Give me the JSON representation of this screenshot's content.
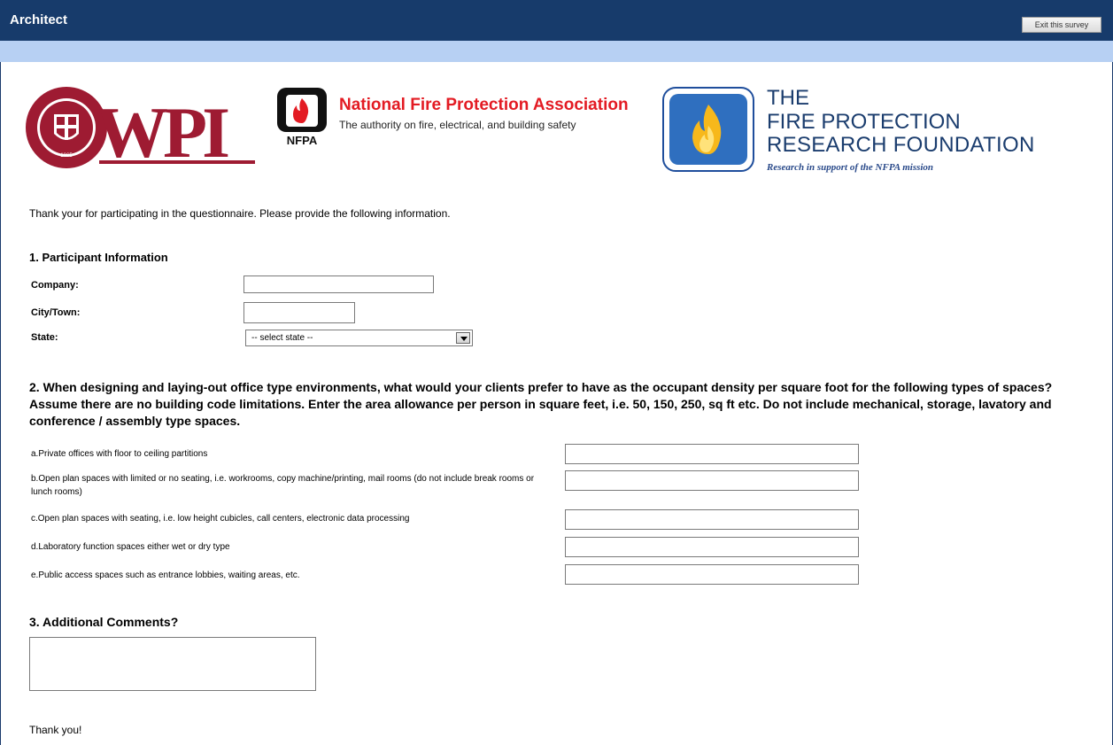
{
  "header": {
    "title": "Architect",
    "exit_label": "Exit this survey"
  },
  "logos": {
    "wpi": "WPI",
    "wpi_ring": "WORCESTER POLYTECHNIC INSTITUTE",
    "wpi_year": "1865",
    "nfpa_mark": "NFPA",
    "nfpa_title": "National Fire Protection Association",
    "nfpa_subtitle": "The authority on fire, electrical, and building safety",
    "frpf_line1": "THE",
    "frpf_line2": "FIRE PROTECTION",
    "frpf_line3": "RESEARCH FOUNDATION",
    "frpf_tagline": "Research in support of the NFPA mission"
  },
  "intro": "Thank your for participating in the questionnaire. Please provide the following information.",
  "q1": {
    "title": "1. Participant Information",
    "company_label": "Company:",
    "company_value": "",
    "city_label": "City/Town:",
    "city_value": "",
    "state_label": "State:",
    "state_selected": "-- select state --"
  },
  "q2": {
    "text": "2. When designing and laying-out office type environments, what would your clients prefer to have as the occupant density per square foot for the following types of spaces? Assume there are no building code limitations. Enter the area allowance per person in square feet, i.e. 50, 150, 250, sq ft etc. Do not include mechanical, storage, lavatory and conference / assembly type spaces.",
    "items": [
      {
        "label": "a.Private offices with floor to ceiling partitions",
        "value": ""
      },
      {
        "label": "b.Open plan spaces with limited or no seating, i.e. workrooms, copy machine/printing, mail rooms (do not include break rooms or lunch rooms)",
        "value": ""
      },
      {
        "label": "c.Open plan spaces with seating, i.e. low height cubicles, call centers, electronic data processing",
        "value": ""
      },
      {
        "label": "d.Laboratory function spaces either wet or dry type",
        "value": ""
      },
      {
        "label": "e.Public access spaces such as entrance lobbies, waiting areas, etc.",
        "value": ""
      }
    ]
  },
  "q3": {
    "title": "3. Additional Comments?",
    "value": ""
  },
  "footer": {
    "thanks": "Thank you!"
  },
  "colors": {
    "header_bg": "#173b6b",
    "subbar_bg": "#b7d0f3",
    "nfpa_red": "#e31b23",
    "wpi_red": "#9e1b32"
  }
}
